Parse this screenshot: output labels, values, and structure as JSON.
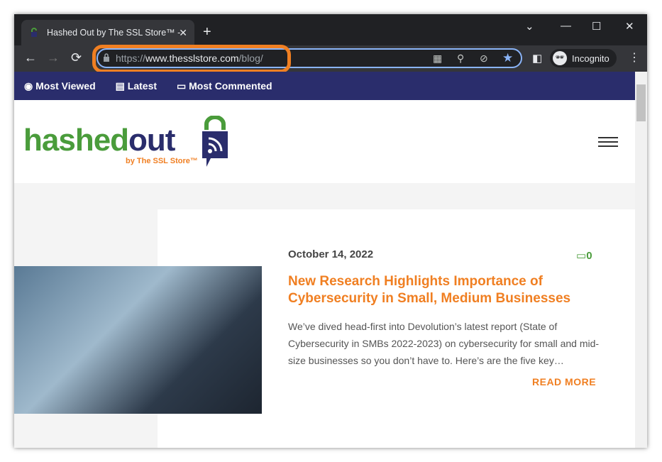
{
  "browser": {
    "tab_title": "Hashed Out by The SSL Store™ -",
    "url_scheme": "https://",
    "url_host": "www.thesslstore.com",
    "url_path": "/blog/",
    "profile": "Incognito",
    "highlight_color": "#f07f22"
  },
  "nav": {
    "items": [
      {
        "label": "Most Viewed",
        "icon": "eye-icon"
      },
      {
        "label": "Latest",
        "icon": "document-icon"
      },
      {
        "label": "Most Commented",
        "icon": "comment-icon"
      }
    ]
  },
  "logo": {
    "part1": "hashed",
    "part2": "out",
    "byline": "by The SSL Store™"
  },
  "post": {
    "date": "October 14, 2022",
    "comments": "0",
    "title": "New Research Highlights Importance of Cybersecurity in Small, Medium Businesses",
    "excerpt": "We’ve dived head-first into Devolution’s latest report (State of Cybersecurity in SMBs 2022-2023) on cybersecurity for small and mid-size businesses so you don’t have to. Here’s are the five key…",
    "read_more": "READ MORE"
  }
}
